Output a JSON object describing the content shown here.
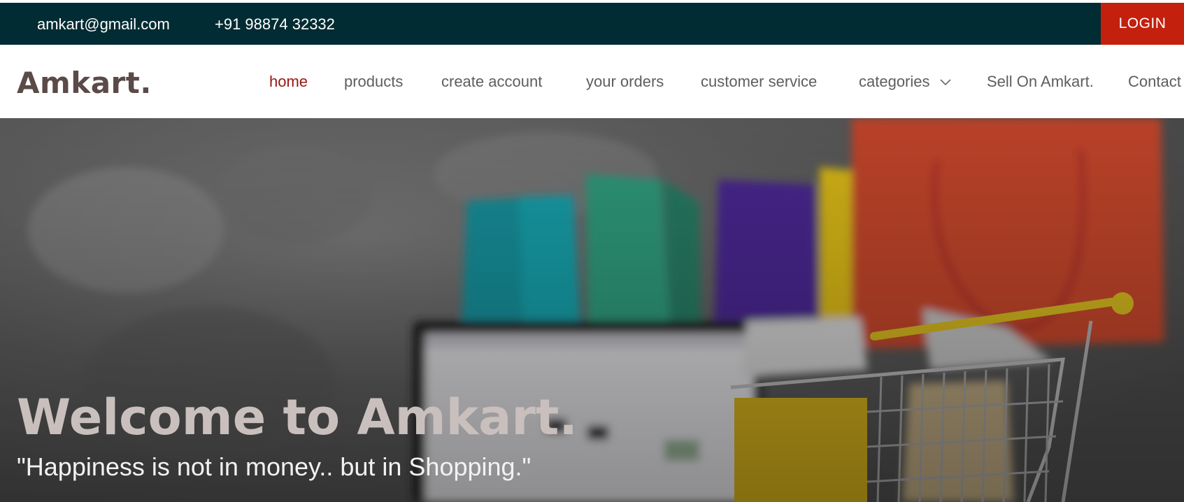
{
  "topbar": {
    "email": "amkart@gmail.com",
    "phone": "+91 98874 32332",
    "login_label": "LOGIN"
  },
  "brand": {
    "logo": "Amkart."
  },
  "nav": {
    "items": [
      {
        "label": "home",
        "active": true
      },
      {
        "label": "products"
      },
      {
        "label": "create account"
      },
      {
        "label": "your orders"
      },
      {
        "label": "customer service"
      },
      {
        "label": "categories",
        "dropdown": true
      },
      {
        "label": "Sell On Amkart."
      },
      {
        "label": "Contact"
      }
    ]
  },
  "hero": {
    "title": "Welcome to Amkart.",
    "subtitle": "\"Happiness is not in money.. but in Shopping.\""
  },
  "colors": {
    "topbar_bg": "#022c33",
    "login_bg": "#c3200e",
    "nav_active": "#9a1510"
  }
}
